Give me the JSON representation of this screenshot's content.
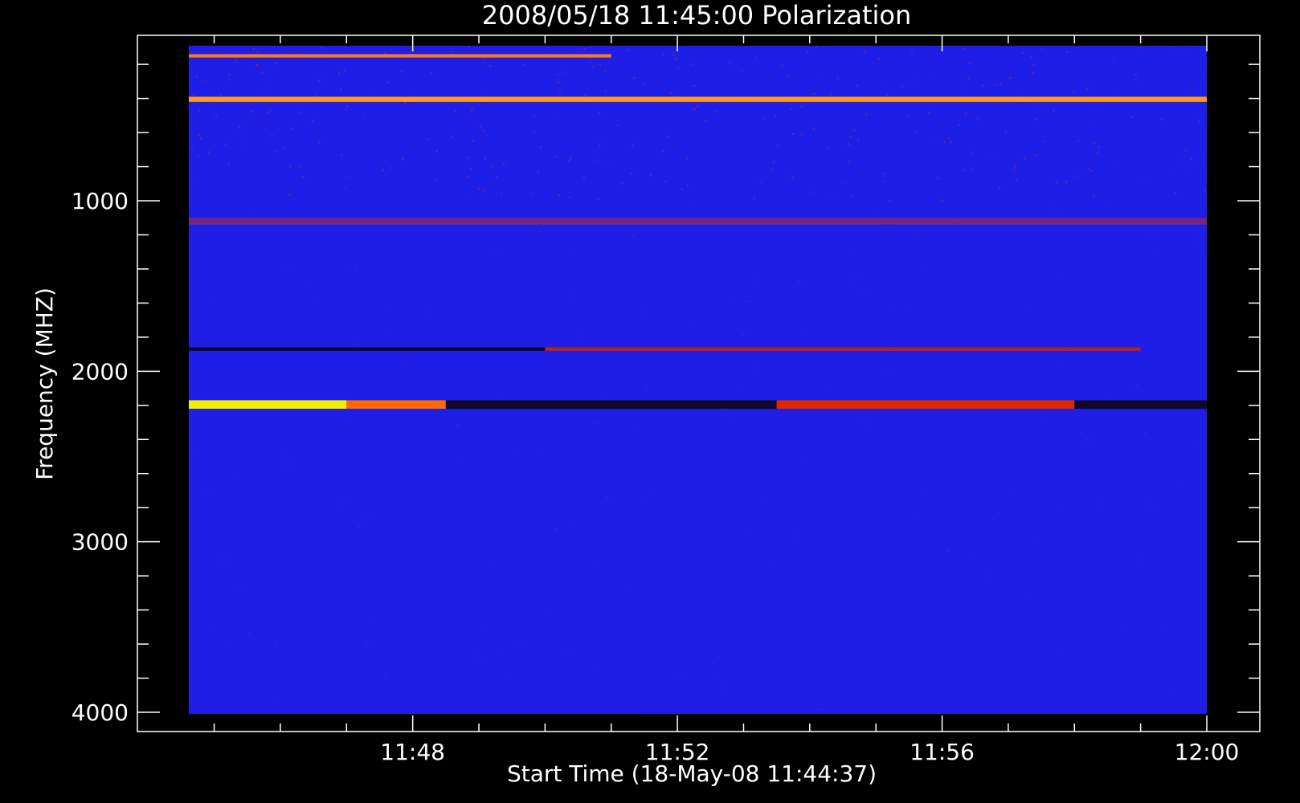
{
  "chart_data": {
    "type": "heatmap",
    "title": "2008/05/18 11:45:00 Polarization",
    "xlabel": "Start Time (18-May-08 11:44:37)",
    "ylabel": "Frequency (MHZ)",
    "x_axis": {
      "unit": "time",
      "range": [
        "11:44:37",
        "12:00:00"
      ],
      "ticks": [
        {
          "value": "11:48",
          "label": "11:48"
        },
        {
          "value": "11:52",
          "label": "11:52"
        },
        {
          "value": "11:56",
          "label": "11:56"
        },
        {
          "value": "12:00",
          "label": "12:00"
        }
      ]
    },
    "y_axis": {
      "unit": "MHz",
      "range": [
        100,
        4050
      ],
      "inverted": true,
      "ticks": [
        {
          "value": 1000,
          "label": "1000"
        },
        {
          "value": 2000,
          "label": "2000"
        },
        {
          "value": 3000,
          "label": "3000"
        },
        {
          "value": 4000,
          "label": "4000"
        }
      ]
    },
    "data_range": {
      "time": [
        "11:44:37",
        "12:00:00"
      ],
      "frequency_mhz": [
        100,
        4000
      ]
    },
    "background_color": "#1e1ee6",
    "features": [
      {
        "description": "bright emission band",
        "freq_mhz": [
          2170,
          2220
        ],
        "time": [
          "11:44:37",
          "11:47:00"
        ],
        "color": "#f0f000"
      },
      {
        "description": "orange emission band",
        "freq_mhz": [
          2170,
          2220
        ],
        "time": [
          "11:47:00",
          "11:48:30"
        ],
        "color": "#ff6a00"
      },
      {
        "description": "dark absorption band",
        "freq_mhz": [
          2170,
          2220
        ],
        "time": [
          "11:48:30",
          "11:53:30"
        ],
        "color": "#100828"
      },
      {
        "description": "red emission band",
        "freq_mhz": [
          2170,
          2220
        ],
        "time": [
          "11:53:30",
          "11:58:00"
        ],
        "color": "#e02800"
      },
      {
        "description": "dark absorption band",
        "freq_mhz": [
          2170,
          2220
        ],
        "time": [
          "11:58:00",
          "12:00:00"
        ],
        "color": "#100828"
      },
      {
        "description": "dark line",
        "freq_mhz": [
          1860,
          1880
        ],
        "time": [
          "11:44:37",
          "11:50:00"
        ],
        "color": "#100828"
      },
      {
        "description": "red line",
        "freq_mhz": [
          1860,
          1880
        ],
        "time": [
          "11:50:00",
          "11:59:00"
        ],
        "color": "#c02010"
      },
      {
        "description": "orange band",
        "freq_mhz": [
          390,
          420
        ],
        "time": [
          "11:44:37",
          "12:00:00"
        ],
        "color": "#ff9a20"
      },
      {
        "description": "dashed orange line",
        "freq_mhz": [
          140,
          160
        ],
        "time": [
          "11:44:37",
          "11:51:00"
        ],
        "color": "#ff7a10"
      },
      {
        "description": "speckled red band",
        "freq_mhz": [
          1100,
          1140
        ],
        "time": [
          "11:44:37",
          "12:00:00"
        ],
        "color": "#b83030"
      }
    ],
    "colors": {
      "emission_high": "#f0f000",
      "emission_mid": "#ff6a00",
      "emission_low": "#c02010",
      "absorption": "#100828",
      "axes": "#ffffff"
    }
  }
}
